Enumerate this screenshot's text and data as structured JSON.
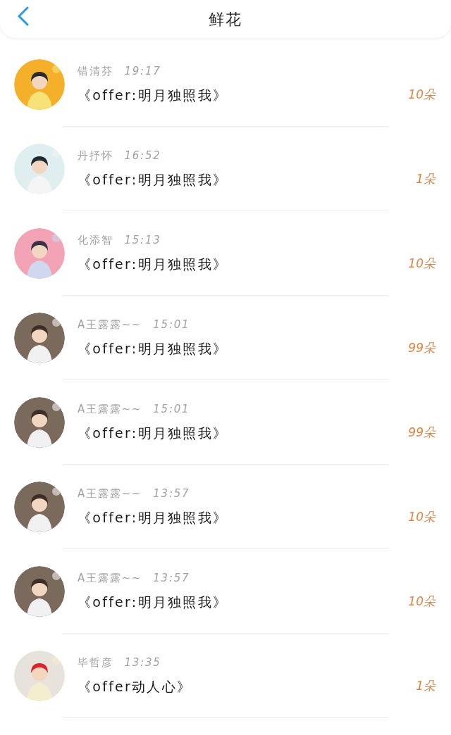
{
  "header": {
    "title": "鲜花"
  },
  "gifts": [
    {
      "name": "错清芬",
      "time": "19:17",
      "message": "《offer:明月独照我》",
      "count": "10朵"
    },
    {
      "name": "丹抒怀",
      "time": "16:52",
      "message": "《offer:明月独照我》",
      "count": "1朵"
    },
    {
      "name": "化添智",
      "time": "15:13",
      "message": "《offer:明月独照我》",
      "count": "10朵"
    },
    {
      "name": "A王露露~~",
      "time": "15:01",
      "message": "《offer:明月独照我》",
      "count": "99朵"
    },
    {
      "name": "A王露露~~",
      "time": "15:01",
      "message": "《offer:明月独照我》",
      "count": "99朵"
    },
    {
      "name": "A王露露~~",
      "time": "13:57",
      "message": "《offer:明月独照我》",
      "count": "10朵"
    },
    {
      "name": "A王露露~~",
      "time": "13:57",
      "message": "《offer:明月独照我》",
      "count": "10朵"
    },
    {
      "name": "毕哲彦",
      "time": "13:35",
      "message": "《offer动人心》",
      "count": "1朵"
    }
  ]
}
